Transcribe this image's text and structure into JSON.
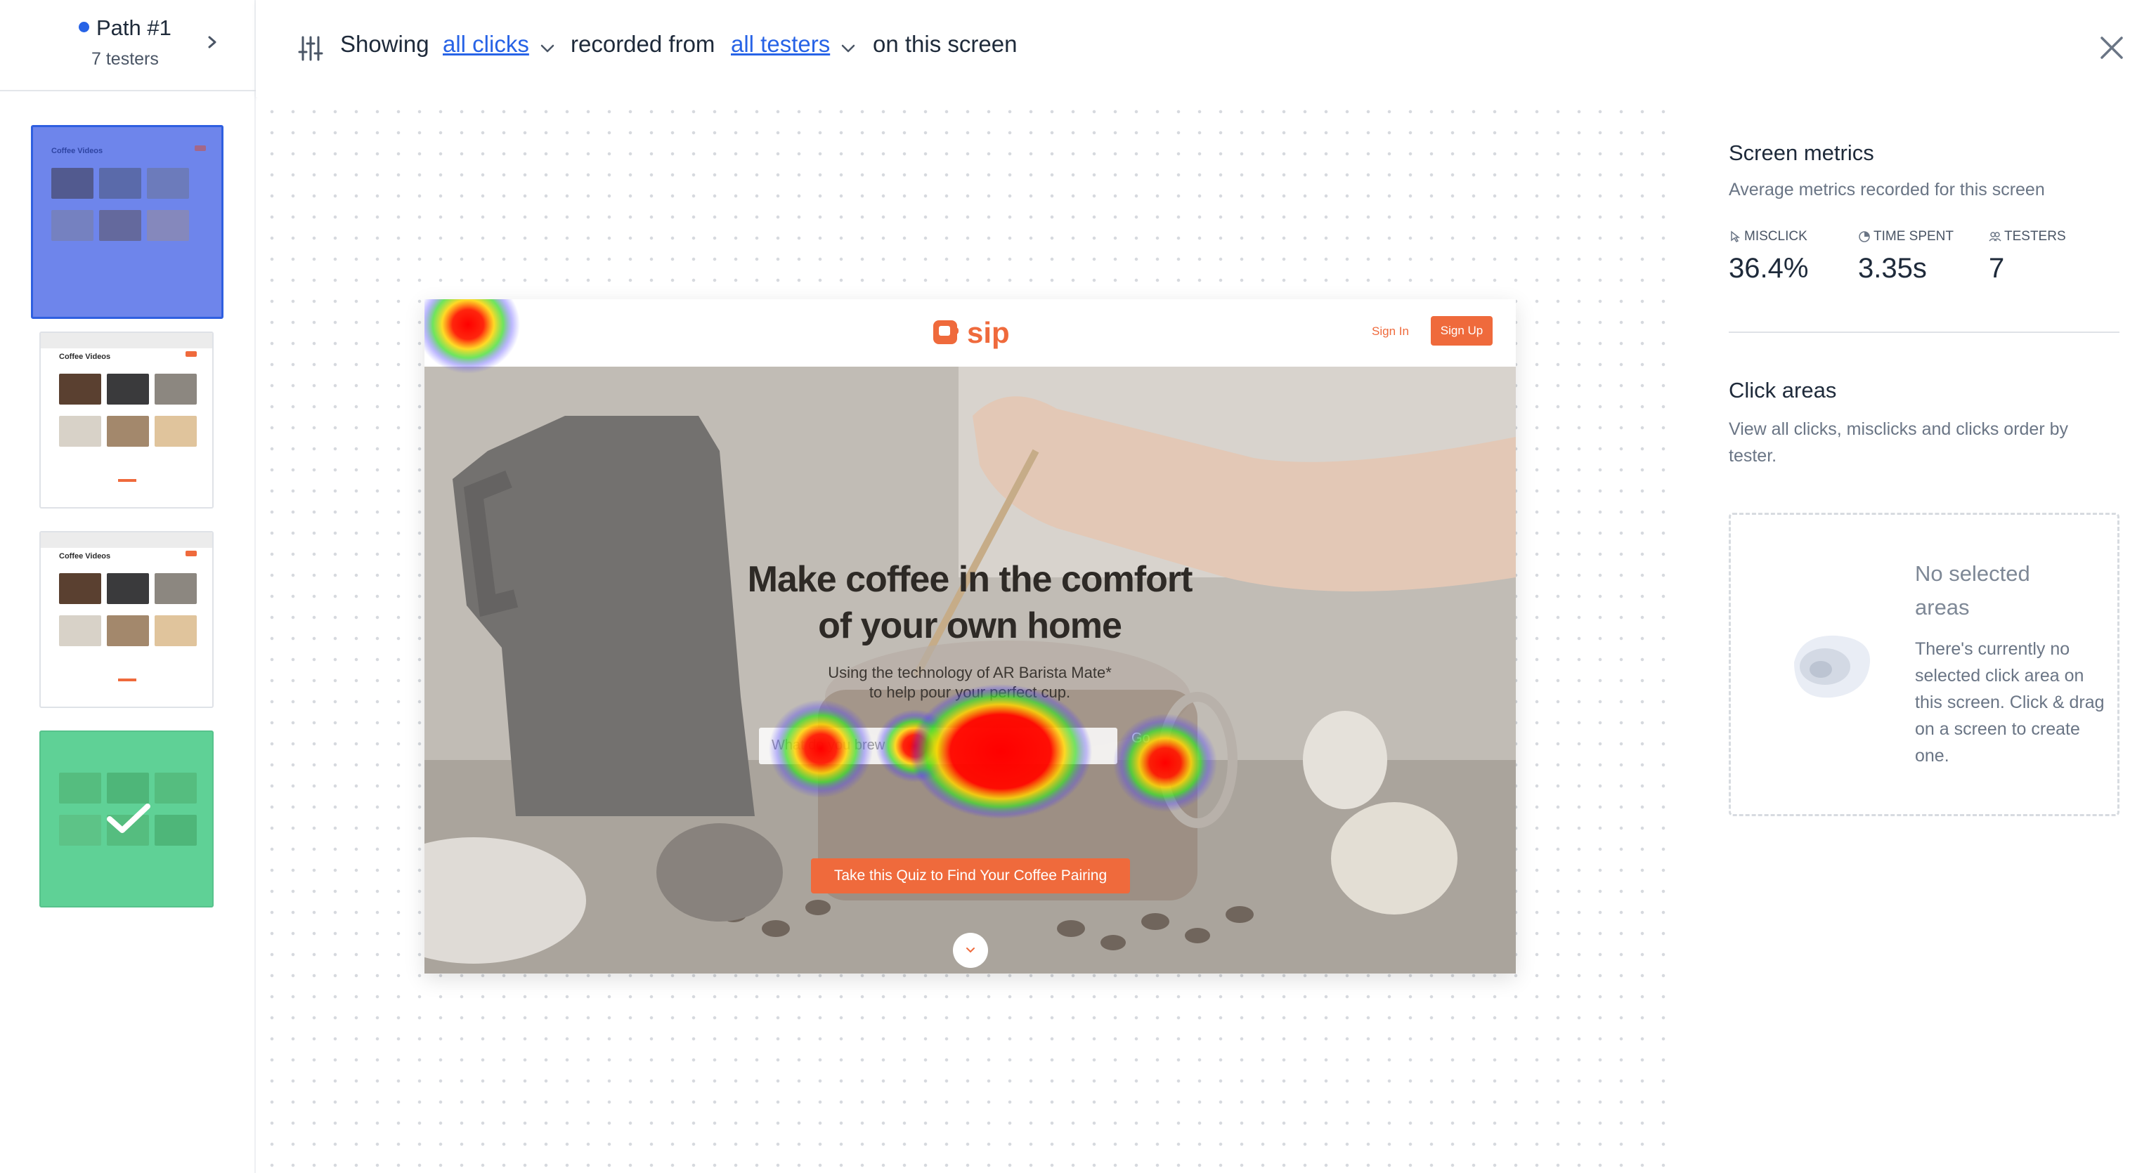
{
  "sidebar": {
    "path_title": "Path #1",
    "path_testers": "7 testers",
    "thumbnails": [
      {
        "title": "Coffee Videos",
        "state": "selected"
      },
      {
        "title": "Coffee Videos",
        "state": "default"
      },
      {
        "title": "Coffee Videos",
        "state": "default"
      },
      {
        "title": "",
        "state": "completed"
      }
    ]
  },
  "toolbar": {
    "showing": "Showing",
    "clicks_filter": "all clicks",
    "recorded_from": "recorded from",
    "testers_filter": "all testers",
    "on_screen": "on this screen"
  },
  "screen": {
    "logo_text": "sip",
    "sign_in": "Sign In",
    "sign_up": "Sign Up",
    "hero_title_line1": "Make coffee in the comfort",
    "hero_title_line2": "of your own home",
    "hero_sub_line1": "Using the technology of AR Barista Mate*",
    "hero_sub_line2": "to help pour your perfect cup.",
    "input_placeholder": "What do you brew",
    "go_label": "Go",
    "quiz_button": "Take this Quiz to Find Your Coffee Pairing",
    "accent_color": "#ef6a3c"
  },
  "heatmap": {
    "clicks": [
      {
        "target": "logo-corner",
        "intensity": 1
      },
      {
        "target": "search-input-left",
        "intensity": 1
      },
      {
        "target": "search-input-mid",
        "intensity": 0.8
      },
      {
        "target": "search-input-right",
        "intensity": 2
      },
      {
        "target": "go-button",
        "intensity": 1
      }
    ]
  },
  "panel": {
    "metrics_title": "Screen metrics",
    "metrics_sub": "Average metrics recorded for this screen",
    "misclick_label": "MISCLICK",
    "misclick_value": "36.4%",
    "time_label": "TIME SPENT",
    "time_value": "3.35s",
    "testers_label": "TESTERS",
    "testers_value": "7",
    "click_title": "Click areas",
    "click_sub": "View all clicks, misclicks and clicks order by tester.",
    "empty_title": "No selected areas",
    "empty_text": "There's currently no selected click area on this screen. Click & drag on a screen to create one."
  },
  "colors": {
    "link": "#2763e6",
    "selected_thumb": "#2f5fe0",
    "completed_thumb": "#57c28c"
  }
}
